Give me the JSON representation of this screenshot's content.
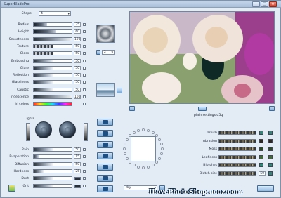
{
  "window": {
    "title": "SuperBladePro",
    "controls": [
      "_",
      "□",
      "✕"
    ]
  },
  "shape": {
    "label": "Shape",
    "value": "4"
  },
  "sliders": [
    {
      "label": "Radius",
      "value": "35",
      "level": 0.35,
      "style": "dark"
    },
    {
      "label": "Height",
      "value": "60",
      "level": 0.6,
      "style": "dark"
    },
    {
      "label": "Smoothness",
      "value": "100",
      "level": 1.0,
      "style": "gray"
    },
    {
      "label": "Texture",
      "value": "50",
      "level": 0.5,
      "style": "texture"
    },
    {
      "label": "Gloss",
      "value": "50",
      "level": 0.5,
      "style": "texture"
    },
    {
      "label": "Embossing",
      "value": "50",
      "level": 0.5,
      "style": "gray"
    },
    {
      "label": "Glare",
      "value": "50",
      "level": 0.5,
      "style": "gray"
    },
    {
      "label": "Reflection",
      "value": "50",
      "level": 0.5,
      "style": "gray"
    },
    {
      "label": "Glassiness",
      "value": "50",
      "level": 0.5,
      "style": "gray"
    },
    {
      "label": "Caustic",
      "value": "50",
      "level": 0.5,
      "style": "gray"
    },
    {
      "label": "Iridescence",
      "value": "100",
      "level": 1.0,
      "style": "gray"
    },
    {
      "label": "Iri colors",
      "value": "",
      "level": 1.0,
      "style": "rainbow"
    }
  ],
  "lights": {
    "label": "Lights"
  },
  "lower_sliders": [
    {
      "label": "Rain",
      "value": "50",
      "level": 0.5
    },
    {
      "label": "Evaporation",
      "value": "15",
      "level": 0.15
    },
    {
      "label": "Diffusion",
      "value": "50",
      "level": 0.5
    },
    {
      "label": "Hardness",
      "value": "25",
      "level": 0.25
    },
    {
      "label": "Dust",
      "value": "",
      "level": 0.5
    },
    {
      "label": "Grit",
      "value": "",
      "level": 0.5
    }
  ],
  "texture_combo": {
    "value": "2"
  },
  "preview": {
    "filename": "plain settings.q5q"
  },
  "right_params": [
    {
      "label": "Tarnish",
      "color": "#2e8a78"
    },
    {
      "label": "Abrasion",
      "color": "#2d2a22"
    },
    {
      "label": "Moss",
      "color": "#2b4a2a"
    },
    {
      "label": "Leafiness",
      "color": "#3f6b34"
    },
    {
      "label": "Blotches",
      "color": "#2e8a78"
    },
    {
      "label": "Blotch size",
      "value": "50"
    }
  ],
  "bottom_combo": {
    "value": "dry"
  },
  "watermark": "ILovePhotoShop.ucoz.com",
  "colors": {
    "accent": "#3b78b8",
    "panel": "#e3ebf5"
  }
}
